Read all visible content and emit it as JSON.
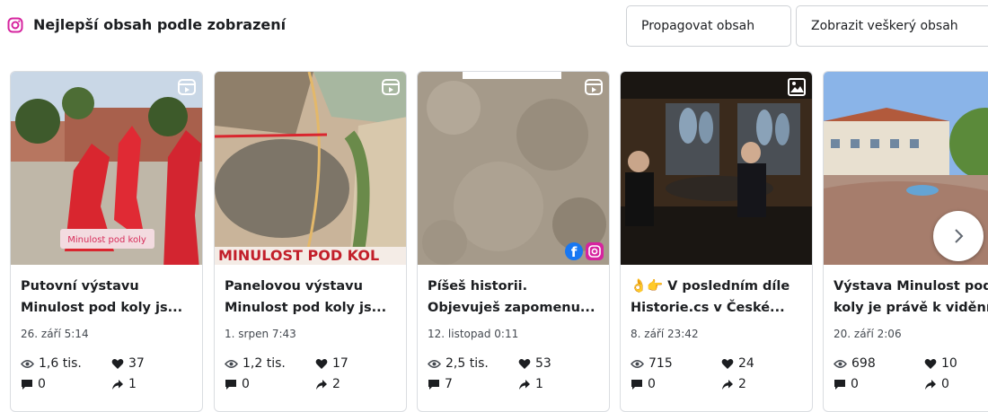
{
  "header": {
    "title": "Nejlepší obsah podle zobrazení",
    "promote_label": "Propagovat obsah",
    "view_all_label": "Zobrazit veškerý obsah",
    "brand_color": "#d6249f"
  },
  "posts": [
    {
      "caption_line1": "Putovní výstavu",
      "caption_line2": "Minulost pod koly js...",
      "thumb_overlay": "Minulost pod koly",
      "date": "26. září 5:14",
      "views": "1,6 tis.",
      "likes": "37",
      "comments": "0",
      "shares": "1",
      "media_type_icon": "reel-icon"
    },
    {
      "caption_line1": "Panelovou výstavu",
      "caption_line2": "Minulost pod koly js...",
      "thumb_overlay": "MINULOST POD KOL",
      "date": "1. srpen 7:43",
      "views": "1,2 tis.",
      "likes": "17",
      "comments": "0",
      "shares": "2",
      "media_type_icon": "reel-icon"
    },
    {
      "caption_line1": "Píšeš historii.",
      "caption_line2": "Objevuješ zapomenu...",
      "date": "12. listopad 0:11",
      "views": "2,5 tis.",
      "likes": "53",
      "comments": "7",
      "shares": "1",
      "media_type_icon": "reel-icon",
      "platform_icons": "facebook-instagram-icon"
    },
    {
      "caption_line1": "👌👉 V posledním díle",
      "caption_line2": "Historie.cs v České...",
      "date": "8. září 23:42",
      "views": "715",
      "likes": "24",
      "comments": "0",
      "shares": "2",
      "media_type_icon": "image-icon"
    },
    {
      "caption_line1": "Výstava Minulost pod",
      "caption_line2": "koly je právě k vidění",
      "date": "20. září 2:06",
      "views": "698",
      "likes": "10",
      "comments": "0",
      "shares": "0",
      "media_type_icon": "reel-icon"
    }
  ],
  "carousel": {
    "next_icon": "chevron-right-icon"
  }
}
